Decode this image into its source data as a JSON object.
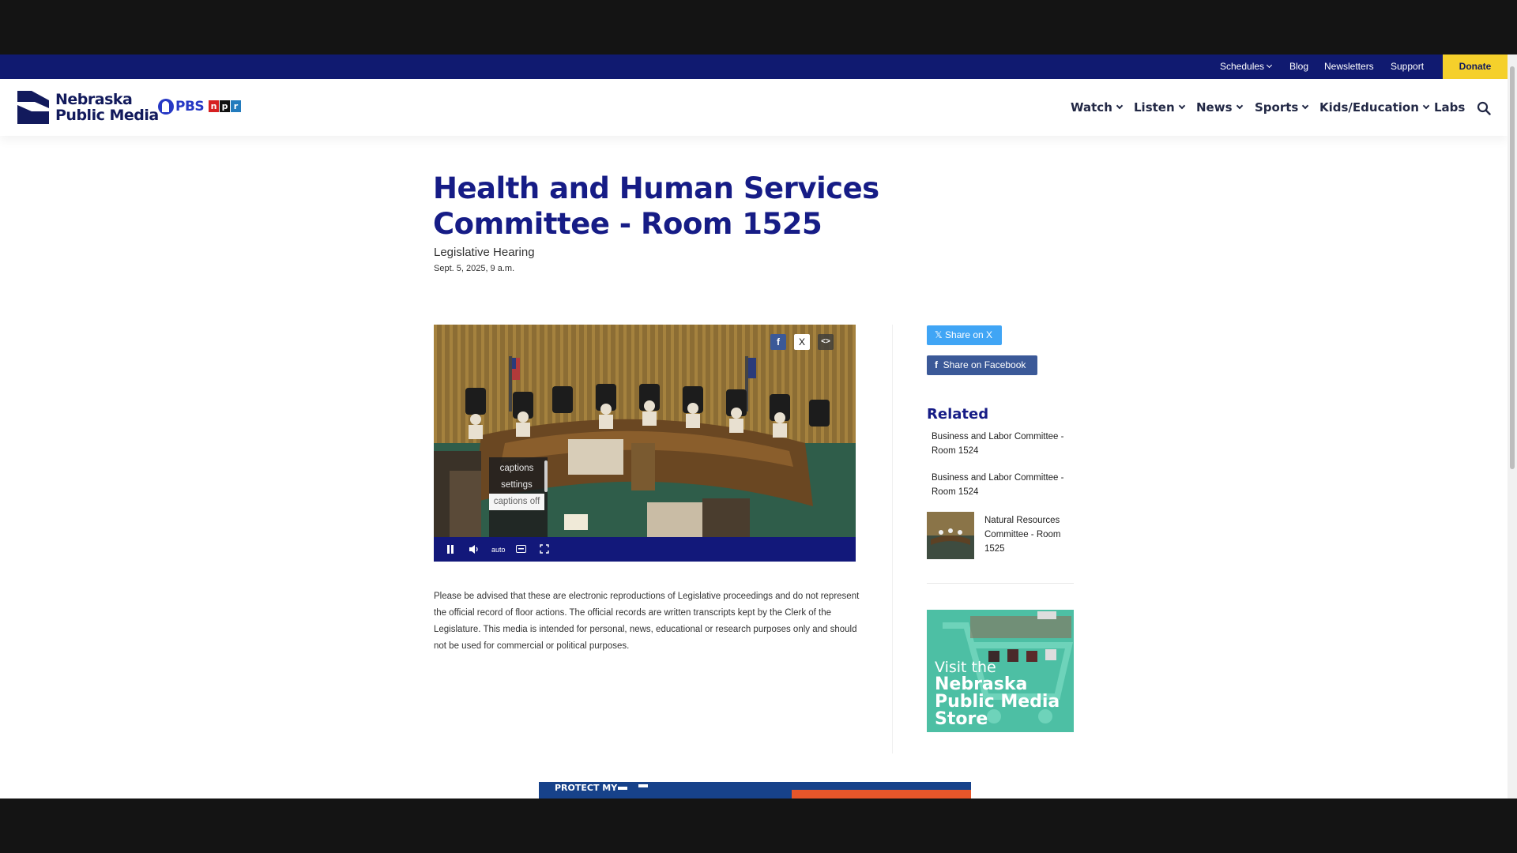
{
  "utility_nav": {
    "schedules": "Schedules",
    "blog": "Blog",
    "newsletters": "Newsletters",
    "support": "Support",
    "donate": "Donate"
  },
  "brand": {
    "line1": "Nebraska",
    "line2": "Public Media",
    "pbs": "PBS",
    "npr": [
      "n",
      "p",
      "r"
    ],
    "navy": "#101a70",
    "accent_yellow": "#f5d02b",
    "title_blue": "#161c86"
  },
  "main_nav": {
    "watch": "Watch",
    "listen": "Listen",
    "news": "News",
    "sports": "Sports",
    "kids": "Kids/Education",
    "labs": "Labs",
    "search_icon": "search-icon"
  },
  "article": {
    "title": "Health and Human Services Committee - Room 1525",
    "subtitle": "Legislative Hearing",
    "date": "Sept. 5, 2025, 9 a.m.",
    "disclaimer": "Please be advised that these are electronic reproductions of Legislative proceedings and do not represent the official record of floor actions. The official records are written transcripts kept by the Clerk of the Legislature. This media is intended for personal, news, educational or research purposes only and should not be used for commercial or political purposes."
  },
  "player": {
    "share_facebook": "f",
    "share_x": "X",
    "embed": "<>",
    "captions_menu": [
      "captions settings",
      "captions off"
    ],
    "controls": {
      "pause_icon": "pause-icon",
      "volume_icon": "volume-icon",
      "quality": "auto",
      "captions_icon": "captions-icon",
      "fullscreen_icon": "fullscreen-icon"
    }
  },
  "sidebar": {
    "share_x": "Share on X",
    "share_facebook": "Share on Facebook",
    "related_heading": "Related",
    "related": [
      {
        "title": "Business and Labor Committee - Room 1524"
      },
      {
        "title": "Business and Labor Committee - Room 1524"
      },
      {
        "title": "Natural Resources Committee - Room 1525"
      }
    ],
    "store_ad": {
      "line1": "Visit the",
      "line2": "Nebraska",
      "line3": "Public Media",
      "line4": "Store"
    }
  },
  "bottom_ad": {
    "text": "PROTECT MY"
  }
}
